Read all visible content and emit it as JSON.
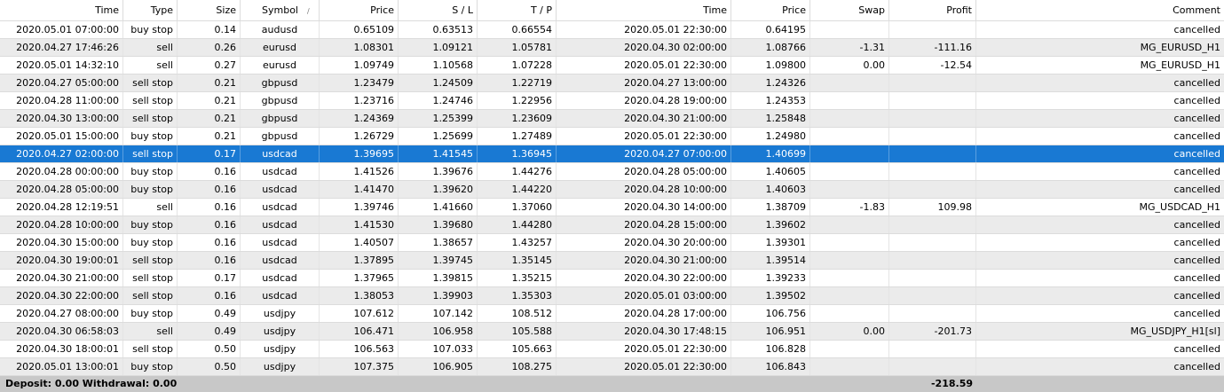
{
  "header": {
    "time": "Time",
    "type": "Type",
    "size": "Size",
    "symbol": "Symbol",
    "price": "Price",
    "sl": "S / L",
    "tp": "T / P",
    "time2": "Time",
    "price2": "Price",
    "swap": "Swap",
    "profit": "Profit",
    "comment": "Comment"
  },
  "rows": [
    [
      "2020.05.01 07:00:00",
      "buy stop",
      "0.14",
      "audusd",
      "0.65109",
      "0.63513",
      "0.66554",
      "2020.05.01 22:30:00",
      "0.64195",
      "",
      "",
      "cancelled"
    ],
    [
      "2020.04.27 17:46:26",
      "sell",
      "0.26",
      "eurusd",
      "1.08301",
      "1.09121",
      "1.05781",
      "2020.04.30 02:00:00",
      "1.08766",
      "-1.31",
      "-111.16",
      "MG_EURUSD_H1"
    ],
    [
      "2020.05.01 14:32:10",
      "sell",
      "0.27",
      "eurusd",
      "1.09749",
      "1.10568",
      "1.07228",
      "2020.05.01 22:30:00",
      "1.09800",
      "0.00",
      "-12.54",
      "MG_EURUSD_H1"
    ],
    [
      "2020.04.27 05:00:00",
      "sell stop",
      "0.21",
      "gbpusd",
      "1.23479",
      "1.24509",
      "1.22719",
      "2020.04.27 13:00:00",
      "1.24326",
      "",
      "",
      "cancelled"
    ],
    [
      "2020.04.28 11:00:00",
      "sell stop",
      "0.21",
      "gbpusd",
      "1.23716",
      "1.24746",
      "1.22956",
      "2020.04.28 19:00:00",
      "1.24353",
      "",
      "",
      "cancelled"
    ],
    [
      "2020.04.30 13:00:00",
      "sell stop",
      "0.21",
      "gbpusd",
      "1.24369",
      "1.25399",
      "1.23609",
      "2020.04.30 21:00:00",
      "1.25848",
      "",
      "",
      "cancelled"
    ],
    [
      "2020.05.01 15:00:00",
      "buy stop",
      "0.21",
      "gbpusd",
      "1.26729",
      "1.25699",
      "1.27489",
      "2020.05.01 22:30:00",
      "1.24980",
      "",
      "",
      "cancelled"
    ],
    [
      "2020.04.27 02:00:00",
      "sell stop",
      "0.17",
      "usdcad",
      "1.39695",
      "1.41545",
      "1.36945",
      "2020.04.27 07:00:00",
      "1.40699",
      "",
      "",
      "cancelled"
    ],
    [
      "2020.04.28 00:00:00",
      "buy stop",
      "0.16",
      "usdcad",
      "1.41526",
      "1.39676",
      "1.44276",
      "2020.04.28 05:00:00",
      "1.40605",
      "",
      "",
      "cancelled"
    ],
    [
      "2020.04.28 05:00:00",
      "buy stop",
      "0.16",
      "usdcad",
      "1.41470",
      "1.39620",
      "1.44220",
      "2020.04.28 10:00:00",
      "1.40603",
      "",
      "",
      "cancelled"
    ],
    [
      "2020.04.28 12:19:51",
      "sell",
      "0.16",
      "usdcad",
      "1.39746",
      "1.41660",
      "1.37060",
      "2020.04.30 14:00:00",
      "1.38709",
      "-1.83",
      "109.98",
      "MG_USDCAD_H1"
    ],
    [
      "2020.04.28 10:00:00",
      "buy stop",
      "0.16",
      "usdcad",
      "1.41530",
      "1.39680",
      "1.44280",
      "2020.04.28 15:00:00",
      "1.39602",
      "",
      "",
      "cancelled"
    ],
    [
      "2020.04.30 15:00:00",
      "buy stop",
      "0.16",
      "usdcad",
      "1.40507",
      "1.38657",
      "1.43257",
      "2020.04.30 20:00:00",
      "1.39301",
      "",
      "",
      "cancelled"
    ],
    [
      "2020.04.30 19:00:01",
      "sell stop",
      "0.16",
      "usdcad",
      "1.37895",
      "1.39745",
      "1.35145",
      "2020.04.30 21:00:00",
      "1.39514",
      "",
      "",
      "cancelled"
    ],
    [
      "2020.04.30 21:00:00",
      "sell stop",
      "0.17",
      "usdcad",
      "1.37965",
      "1.39815",
      "1.35215",
      "2020.04.30 22:00:00",
      "1.39233",
      "",
      "",
      "cancelled"
    ],
    [
      "2020.04.30 22:00:00",
      "sell stop",
      "0.16",
      "usdcad",
      "1.38053",
      "1.39903",
      "1.35303",
      "2020.05.01 03:00:00",
      "1.39502",
      "",
      "",
      "cancelled"
    ],
    [
      "2020.04.27 08:00:00",
      "buy stop",
      "0.49",
      "usdjpy",
      "107.612",
      "107.142",
      "108.512",
      "2020.04.28 17:00:00",
      "106.756",
      "",
      "",
      "cancelled"
    ],
    [
      "2020.04.30 06:58:03",
      "sell",
      "0.49",
      "usdjpy",
      "106.471",
      "106.958",
      "105.588",
      "2020.04.30 17:48:15",
      "106.951",
      "0.00",
      "-201.73",
      "MG_USDJPY_H1[sl]"
    ],
    [
      "2020.04.30 18:00:01",
      "sell stop",
      "0.50",
      "usdjpy",
      "106.563",
      "107.033",
      "105.663",
      "2020.05.01 22:30:00",
      "106.828",
      "",
      "",
      "cancelled"
    ],
    [
      "2020.05.01 13:00:01",
      "buy stop",
      "0.50",
      "usdjpy",
      "107.375",
      "106.905",
      "108.275",
      "2020.05.01 22:30:00",
      "106.843",
      "",
      "",
      "cancelled"
    ]
  ],
  "selected_row_index": 7,
  "footer": {
    "summary": "Deposit: 0.00  Withdrawal: 0.00",
    "total_profit": "-218.59"
  },
  "colors": {
    "selection": "#1979d3",
    "alt_row": "#ebebeb",
    "footer": "#c8c8c8"
  },
  "icons": {
    "sort": "sort-indicator-icon"
  }
}
